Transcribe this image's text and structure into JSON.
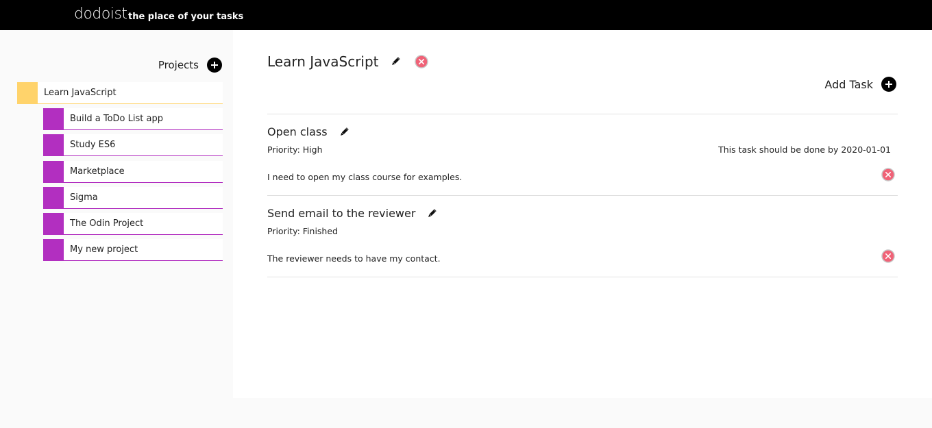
{
  "header": {
    "logo": "dodoist",
    "tagline": "the place of your tasks",
    "background_color": "#000000"
  },
  "sidebar": {
    "title": "Projects",
    "add_icon": "plus-circle-icon",
    "items": [
      {
        "label": "Learn JavaScript",
        "color": "#ffd36b",
        "active": true
      },
      {
        "label": "Build a ToDo List app",
        "color": "#b22fc0"
      },
      {
        "label": "Study ES6",
        "color": "#b22fc0"
      },
      {
        "label": "Marketplace",
        "color": "#b22fc0"
      },
      {
        "label": "Sigma",
        "color": "#b22fc0"
      },
      {
        "label": "The Odin Project",
        "color": "#b22fc0"
      },
      {
        "label": "My new project",
        "color": "#b22fc0"
      }
    ]
  },
  "main": {
    "project_title": "Learn JavaScript",
    "edit_icon": "pencil-icon",
    "delete_icon": "close-circle-icon",
    "add_task_label": "Add Task",
    "tasks": [
      {
        "title": "Open class",
        "priority": "Priority: High",
        "due": "This task should be done by 2020-01-01",
        "description": "I need to open my class course for examples."
      },
      {
        "title": "Send email to the reviewer",
        "priority": "Priority: Finished",
        "due": "",
        "description": "The reviewer needs to have my contact."
      }
    ]
  },
  "colors": {
    "accent_active": "#ffd36b",
    "accent_project": "#b22fc0",
    "delete": "#f06277"
  }
}
